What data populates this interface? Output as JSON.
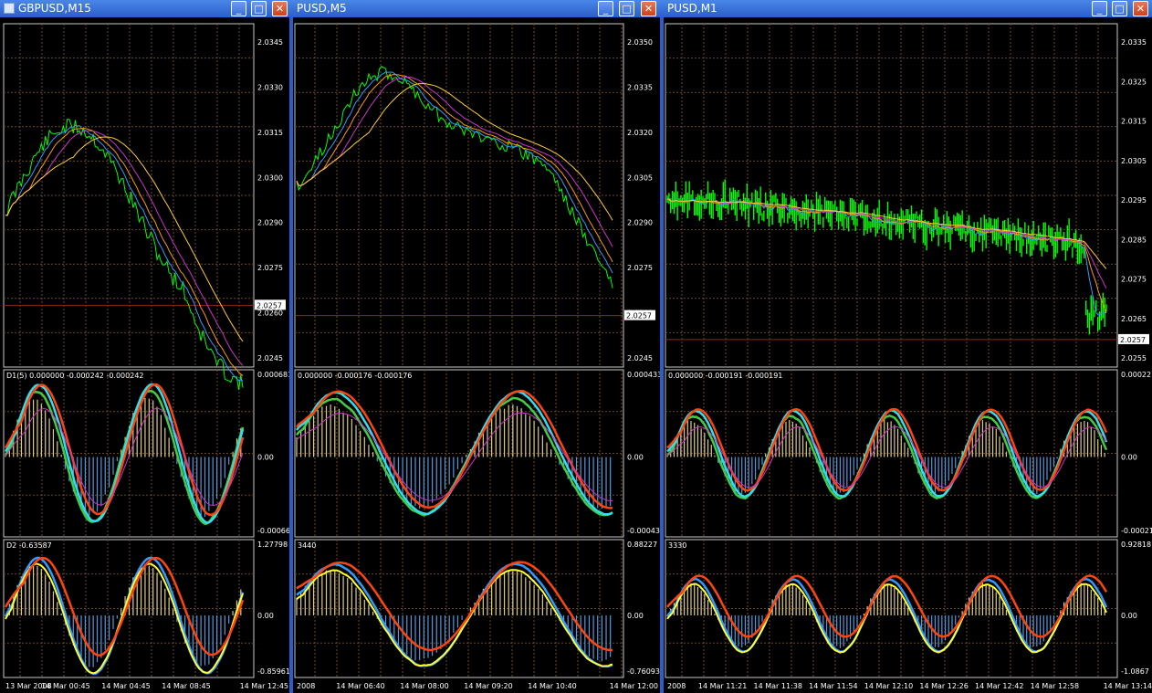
{
  "windows": [
    {
      "title": "GBPUSD,M15",
      "price_labels": [
        "2.0345",
        "2.0330",
        "2.0315",
        "2.0300",
        "2.0290",
        "2.0275",
        "2.0260",
        "2.0245"
      ],
      "current_price": "2.0257",
      "ind1_header": "D1(5) 0.000000 -0.000242 -0.000242",
      "ind1_labels": [
        "0.000681",
        "0.00",
        "-0.00066"
      ],
      "ind2_header": "D2 -0.63587",
      "ind2_labels": [
        "1.27798",
        "0.00",
        "-0.85961"
      ],
      "time_labels": [
        "13 Mar 2008",
        "14 Mar 00:45",
        "14 Mar 04:45",
        "14 Mar 08:45",
        "14 Mar 12:45"
      ]
    },
    {
      "title": "PUSD,M5",
      "price_labels": [
        "2.0350",
        "2.0335",
        "2.0320",
        "2.0305",
        "2.0290",
        "2.0275",
        "2.0260",
        "2.0245"
      ],
      "current_price": "2.0257",
      "ind1_header": "0.000000 -0.000176 -0.000176",
      "ind1_labels": [
        "0.000433",
        "0.00",
        "-0.00043"
      ],
      "ind2_header": "3440",
      "ind2_labels": [
        "0.88227",
        "0.00",
        "-0.76093"
      ],
      "time_labels": [
        "2008",
        "14 Mar 06:40",
        "14 Mar 08:00",
        "14 Mar 09:20",
        "14 Mar 10:40",
        "14 Mar 12:00"
      ]
    },
    {
      "title": "PUSD,M1",
      "price_labels": [
        "2.0335",
        "2.0325",
        "2.0315",
        "2.0305",
        "2.0295",
        "2.0285",
        "2.0275",
        "2.0265",
        "2.0255"
      ],
      "current_price": "2.0257",
      "ind1_header": "0.000000 -0.000191 -0.000191",
      "ind1_labels": [
        "0.00022",
        "0.00",
        "-0.00021"
      ],
      "ind2_header": "3330",
      "ind2_labels": [
        "0.92818",
        "0.00",
        "-1.0867"
      ],
      "time_labels": [
        "2008",
        "14 Mar 11:21",
        "14 Mar 11:38",
        "14 Mar 11:54",
        "14 Mar 12:10",
        "14 Mar 12:26",
        "14 Mar 12:42",
        "14 Mar 12:58",
        "14 Mar 13:14"
      ]
    }
  ],
  "titlebar_buttons": {
    "minimize": "_",
    "maximize": "□",
    "close": "✕"
  },
  "colors": {
    "titlebar": "#2a5fc9",
    "grid": "#6b4a2a",
    "price_line": "#00ff00",
    "ma_blue": "#3399ff",
    "ma_orange": "#ff9900",
    "ma_magenta": "#cc33cc",
    "ma_yellow": "#ffcc33",
    "ind_red": "#ff4411",
    "ind_cyan": "#33ddee",
    "ind_green": "#44cc44",
    "hist_up": "#ddcc88",
    "hist_down": "#5599dd",
    "ind_yellow": "#ffff33",
    "ind_navy": "#1122cc"
  }
}
